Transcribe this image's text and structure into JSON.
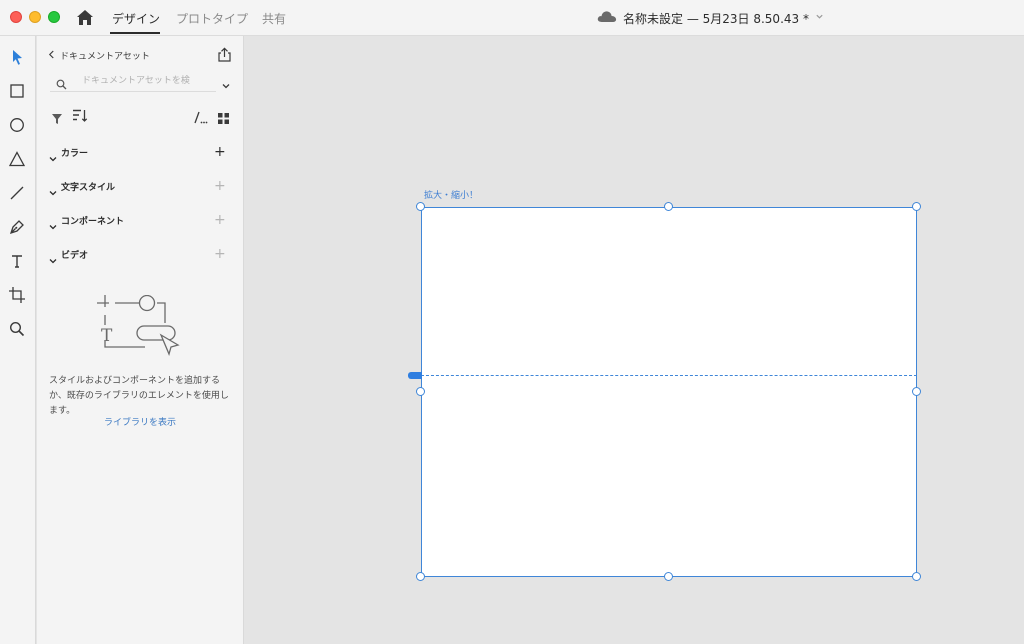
{
  "titlebar": {
    "tabs": [
      {
        "label": "デザイン",
        "active": true
      },
      {
        "label": "プロトタイプ",
        "active": false
      },
      {
        "label": "共有",
        "active": false
      }
    ],
    "document_title": "名称未設定 — 5月23日 8.50.43 *",
    "icons": [
      "home-icon",
      "cloud-icon",
      "chevron-down-icon"
    ]
  },
  "toolbar": {
    "tools": [
      "select-tool",
      "rectangle-tool",
      "ellipse-tool",
      "polygon-tool",
      "line-tool",
      "pen-tool",
      "text-tool",
      "artboard-tool",
      "zoom-tool"
    ]
  },
  "assets_panel": {
    "title": "ドキュメントアセット",
    "search_placeholder": "ドキュメントアセットを検",
    "sections": [
      {
        "label": "カラー"
      },
      {
        "label": "文字スタイル"
      },
      {
        "label": "コンポーネント"
      },
      {
        "label": "ビデオ"
      }
    ],
    "empty_message": "スタイルおよびコンポーネントを追加するか、既存のライブラリのエレメントを使用します。",
    "library_link": "ライブラリを表示"
  },
  "canvas": {
    "artboard_name": "拡大・縮小！"
  },
  "colors": {
    "accent": "#3f86d8",
    "link": "#3a78c2",
    "canvas_bg": "#e4e4e4",
    "panel_bg": "#f4f4f4"
  }
}
